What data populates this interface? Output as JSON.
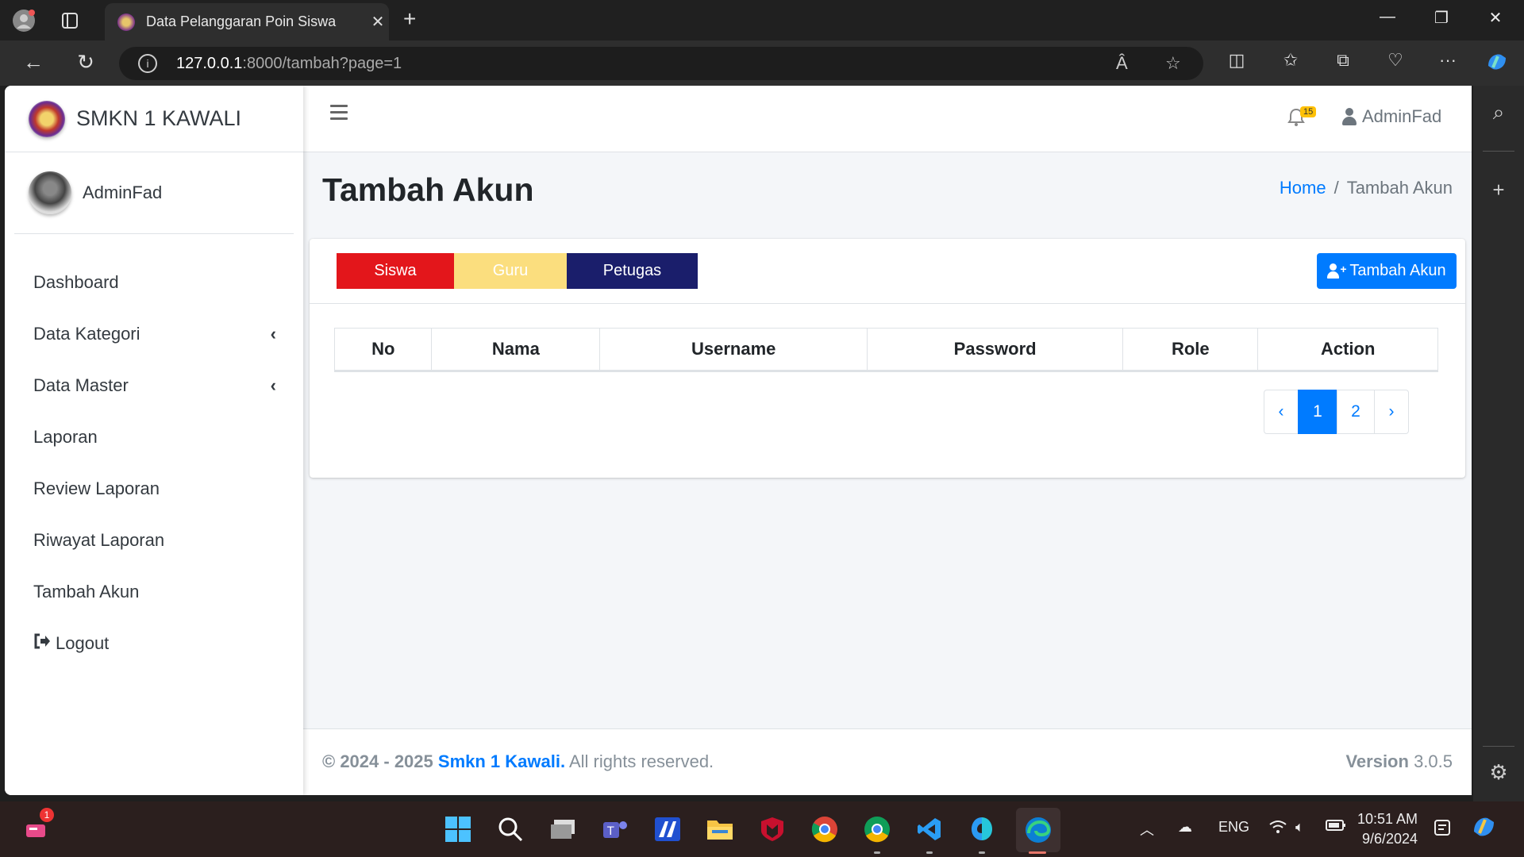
{
  "browser": {
    "tab_title": "Data Pelanggaran Poin Siswa",
    "url_host": "127.0.0.1",
    "url_path": ":8000/tambah?page=1",
    "read_aloud_label": "Â"
  },
  "sidebar": {
    "brand": "SMKN 1 KAWALI",
    "user": "AdminFad",
    "items": [
      {
        "label": "Dashboard",
        "chevron": false
      },
      {
        "label": "Data Kategori",
        "chevron": true
      },
      {
        "label": "Data Master",
        "chevron": true
      },
      {
        "label": "Laporan",
        "chevron": false
      },
      {
        "label": "Review Laporan",
        "chevron": false
      },
      {
        "label": "Riwayat Laporan",
        "chevron": false
      },
      {
        "label": "Tambah Akun",
        "chevron": false
      },
      {
        "label": "Logout",
        "chevron": false,
        "icon": "logout-icon"
      }
    ]
  },
  "topnav": {
    "notification_count": "15",
    "user": "AdminFad"
  },
  "page": {
    "title": "Tambah Akun",
    "breadcrumb_home": "Home",
    "breadcrumb_current": "Tambah Akun"
  },
  "roles": [
    {
      "label": "Siswa",
      "bg": "#e3161b",
      "color": "#ffffff"
    },
    {
      "label": "Guru",
      "bg": "#fbde7e",
      "color": "#ffffff"
    },
    {
      "label": "Petugas",
      "bg": "#1a1e6b",
      "color": "#ffffff"
    }
  ],
  "add_button": "Tambah Akun",
  "table": {
    "headers": [
      "No",
      "Nama",
      "Username",
      "Password",
      "Role",
      "Action"
    ],
    "rows": []
  },
  "pagination": {
    "prev": "‹",
    "pages": [
      "1",
      "2"
    ],
    "active": "1",
    "next": "›"
  },
  "footer": {
    "copyright": "© 2024 - 2025",
    "brand": "Smkn 1 Kawali.",
    "rights": "All rights reserved.",
    "version_label": "Version",
    "version": "3.0.5"
  },
  "taskbar": {
    "lang": "ENG",
    "time": "10:51 AM",
    "date": "9/6/2024",
    "notification_badge": "1"
  },
  "colors": {
    "accent": "#007bff",
    "siswa": "#e3161b",
    "guru": "#fbde7e",
    "petugas": "#1a1e6b"
  }
}
